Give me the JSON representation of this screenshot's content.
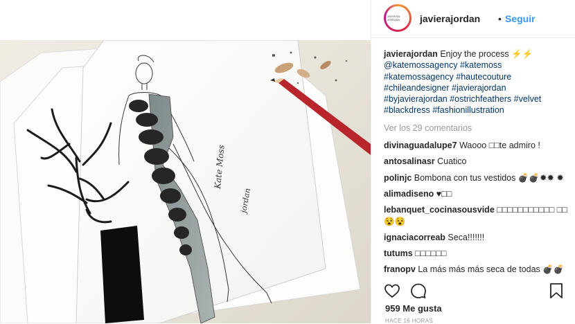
{
  "header": {
    "avatar_text": "JAVIERA JORDAN",
    "username": "javierajordan",
    "separator": "•",
    "follow_label": "Seguir"
  },
  "caption": {
    "user": "javierajordan",
    "text": "Enjoy the process ⚡⚡",
    "hashtags": [
      "@katemossagency",
      "#katemoss",
      "#katemossagency",
      "#hautecouture",
      "#chileandesigner",
      "#javierajordan",
      "#byjavierajordan",
      "#ostrichfeathers",
      "#velvet",
      "#blackdress",
      "#fashionillustration"
    ]
  },
  "view_all": "Ver los 29 comentarios",
  "comments": [
    {
      "user": "divinaguadalupe7",
      "text": "Waooo □□te admiro !"
    },
    {
      "user": "antosalinasr",
      "text": "Cuatico"
    },
    {
      "user": "polinjc",
      "text": "Bombona con tus vestidos 💣💣✹✹ ✹"
    },
    {
      "user": "alimadiseno",
      "text": "♥□□"
    },
    {
      "user": "lebanquet_cocinasousvide",
      "text": "□□□□□□□□□□□ □□😵😵"
    },
    {
      "user": "ignaciacorreab",
      "text": "Seca!!!!!!!"
    },
    {
      "user": "tutums",
      "text": "□□□□□□"
    },
    {
      "user": "franopv",
      "text": "La más más más seca de todas 💣💣"
    }
  ],
  "likes": "959 Me gusta",
  "time": "HACE 16 HORAS",
  "icons": {
    "like": "heart-icon",
    "comment": "comment-icon",
    "save": "bookmark-icon"
  },
  "colors": {
    "accent": "#3897f0",
    "hashtag": "#003569",
    "muted": "#999999"
  },
  "image_text": {
    "signature_1": "Kate Moss",
    "signature_2": "jordan"
  }
}
